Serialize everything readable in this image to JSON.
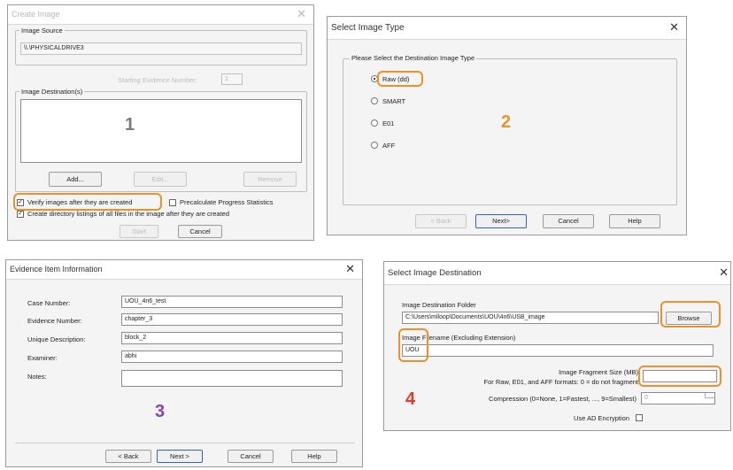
{
  "colors": {
    "highlight": "#e8922d",
    "accent_blue": "#2f62c9",
    "badge_1": "#7a7a7a",
    "badge_2": "#e8922d",
    "badge_3": "#8a3fb3",
    "badge_4": "#e03b2f"
  },
  "create_image": {
    "title": "Create Image",
    "close_icon": "close-icon",
    "source_group_label": "Image Source",
    "source_path": "\\\\.\\PHYSICALDRIVE3",
    "starting_evidence_label": "Starting Evidence Number:",
    "starting_evidence_value": "1",
    "destination_group_label": "Image Destination(s)",
    "badge": "1",
    "add_button": "Add...",
    "edit_button": "Edit...",
    "remove_button": "Remove",
    "verify_label": "Verify images after they are created",
    "precalc_label": "Precalculate Progress Statistics",
    "dirlist_label": "Create directory listings of all files in the image after they are created",
    "start_button": "Start",
    "cancel_button": "Cancel"
  },
  "select_type": {
    "title": "Select Image Type",
    "close_icon": "close-icon",
    "group_label": "Please Select the Destination Image Type",
    "options": [
      "Raw (dd)",
      "SMART",
      "E01",
      "AFF"
    ],
    "selected": "Raw (dd)",
    "badge": "2",
    "back_button": "< Back",
    "next_button": "Next>",
    "cancel_button": "Cancel",
    "help_button": "Help"
  },
  "evidence": {
    "title": "Evidence Item Information",
    "close_icon": "close-icon",
    "fields": [
      {
        "label": "Case Number:",
        "value": "UOU_4n6_test"
      },
      {
        "label": "Evidence Number:",
        "value": "chapter_3"
      },
      {
        "label": "Unique Description:",
        "value": "block_2"
      },
      {
        "label": "Examiner:",
        "value": "abhi"
      },
      {
        "label": "Notes:",
        "value": ""
      }
    ],
    "badge": "3",
    "back_button": "< Back",
    "next_button": "Next >",
    "cancel_button": "Cancel",
    "help_button": "Help"
  },
  "select_dest": {
    "title": "Select Image Destination",
    "close_icon": "close-icon",
    "folder_label": "Image Destination Folder",
    "folder_value": "C:\\Users\\mlloop\\Documents\\UOU\\4n6\\USB_image",
    "browse_button": "Browse",
    "filename_label": "Image Filename (Excluding Extension)",
    "filename_value": "UOU",
    "fragment_label": "Image Fragment Size (MB)",
    "fragment_hint": "For Raw, E01, and AFF formats: 0 = do not fragment",
    "fragment_value": "",
    "compression_label": "Compression (0=None, 1=Fastest, ..., 9=Smallest)",
    "compression_value": "0",
    "ad_encryption_label": "Use AD Encryption",
    "badge": "4"
  }
}
